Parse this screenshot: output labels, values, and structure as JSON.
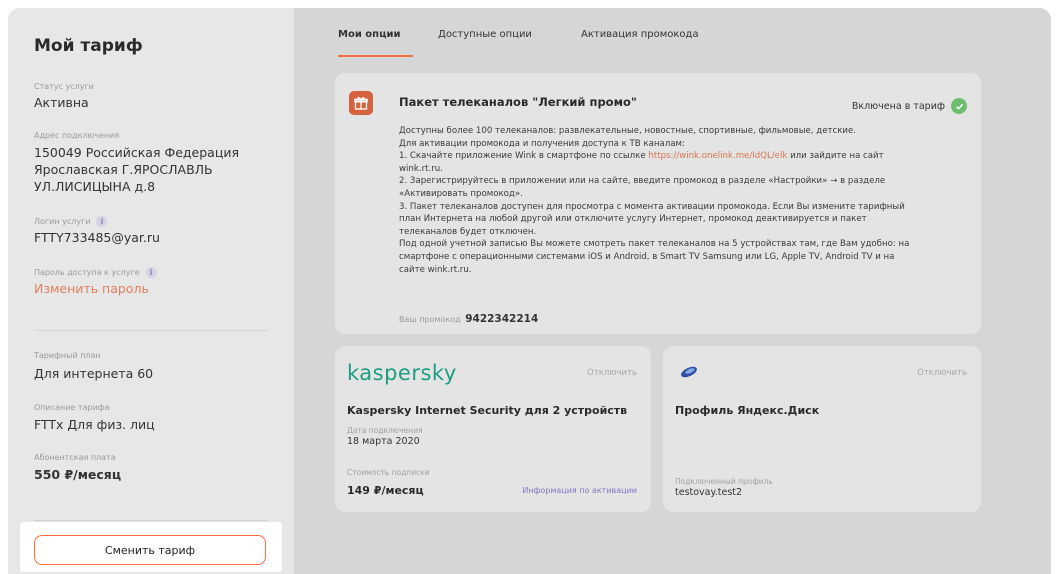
{
  "sidebar": {
    "title": "Мой тариф",
    "status_label": "Статус услуги",
    "status_value": "Активна",
    "address_label": "Адрес подключения",
    "address_lines": [
      "150049 Российская Федерация",
      "Ярославская Г.ЯРОСЛАВЛЬ",
      "УЛ.ЛИСИЦЫНА д.8"
    ],
    "login_label": "Логин услуги",
    "login_value": "FTTY733485@yar.ru",
    "password_label": "Пароль доступа к услуге",
    "password_link": "Изменить пароль",
    "plan_label": "Тарифный план",
    "plan_value": "Для интернета 60",
    "plan_desc_label": "Описание тарифа",
    "plan_desc_value": "FTTx Для физ. лиц",
    "fee_label": "Абонентская плата",
    "fee_value": "550 ₽/месяц",
    "change_button": "Сменить тариф",
    "info_glyph": "i"
  },
  "tabs": [
    {
      "label": "Мои опции",
      "active": true
    },
    {
      "label": "Доступные опции",
      "active": false
    },
    {
      "label": "Активация промокода",
      "active": false
    }
  ],
  "package": {
    "title": "Пакет телеканалов \"Легкий промо\"",
    "status": "Включена в тариф",
    "lines": [
      "Доступны более 100 телеканалов: развлекательные, новостные, спортивные, фильмовые, детские.",
      "Для активации промокода и получения доступа к ТВ каналам:",
      "1. Скачайте приложение Wink в смартфоне по ссылке",
      "wink.rt.ru.",
      "2. Зарегистрируйтесь в приложении или на сайте, введите промокод в разделе «Настройки» → в разделе",
      "«Активировать промокод».",
      "3. Пакет телеканалов доступен для просмотра с момента активации промокода. Если Вы измените тарифный",
      "план Интернета на любой другой или отключите услугу Интернет, промокод деактивируется и пакет",
      "телеканалов будет отключен.",
      "Под одной учетной записью Вы можете смотреть пакет телеканалов на 5 устройствах там, где Вам удобно: на",
      "смартфоне с операционными системами iOS и Android, в Smart TV Samsung или LG, Apple TV, Android TV и на",
      "сайте wink.rt.ru."
    ],
    "link": "https://wink.onelink.me/IdQL/elk",
    "link_suffix": "или зайдите на сайт",
    "promo_label": "Ваш промокод",
    "promo_code": "9422342214"
  },
  "kaspersky": {
    "logo": "kaspersky",
    "disable": "Отключить",
    "title": "Kaspersky Internet Security для 2 устройств",
    "date_label": "Дата подключения",
    "date_value": "18 марта 2020",
    "cost_label": "Стоимость подписки",
    "price": "149 ₽/месяц",
    "info_link": "Информация по активации"
  },
  "yandex_disk": {
    "disable": "Отключить",
    "title": "Профиль Яндекс.Диск",
    "profile_label": "Подключенный профиль",
    "profile_value": "testovay.test2"
  },
  "colors": {
    "accent": "#f36b40",
    "kaspersky_green": "#1c9e82",
    "link_purple": "#8077c4",
    "check_green": "#6dbd6d"
  },
  "icons": [
    "info-icon",
    "gift-icon",
    "check-icon",
    "yandex-disk-icon"
  ]
}
